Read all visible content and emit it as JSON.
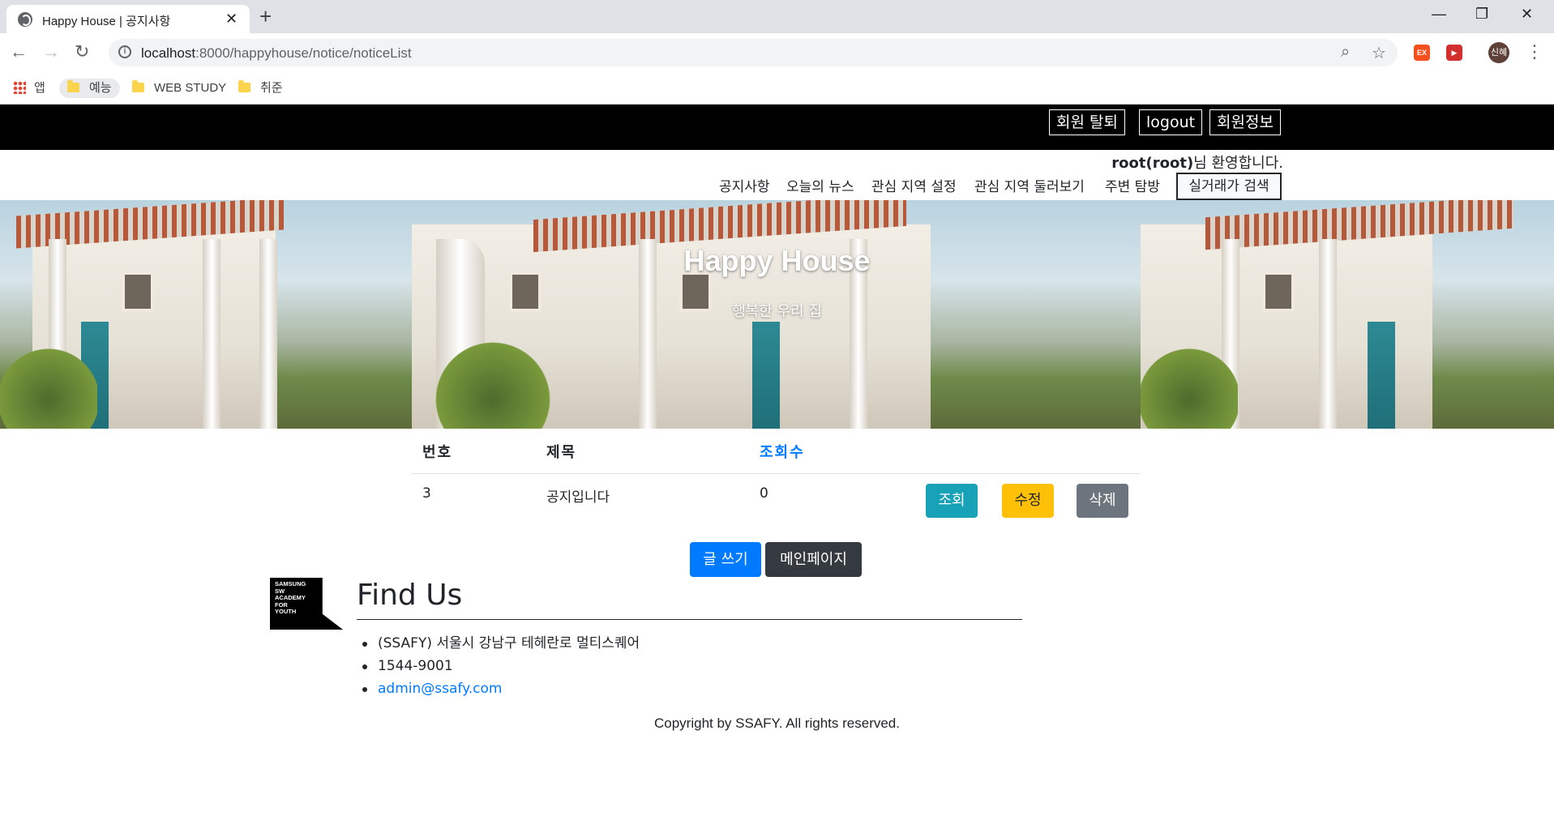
{
  "browser": {
    "tab_title": "Happy House | 공지사항",
    "tab_close": "✕",
    "new_tab": "+",
    "url_host": "localhost",
    "url_rest": ":8000/happyhouse/notice/noticeList",
    "profile_initial": "신혜",
    "window_controls": [
      "—",
      "❐",
      "✕"
    ],
    "bookmarks": [
      {
        "label": "앱",
        "icon": "apps-grid-icon"
      },
      {
        "label": "예능",
        "icon": "folder-icon"
      },
      {
        "label": "WEB STUDY",
        "icon": "folder-icon"
      },
      {
        "label": "취준",
        "icon": "folder-icon"
      }
    ],
    "extensions": [
      {
        "label": "EX",
        "color": "#f4511e"
      },
      {
        "label": "▶",
        "color": "#d32f2f"
      }
    ]
  },
  "topbar": {
    "buttons": [
      "회원 탈퇴",
      "logout",
      "회원정보"
    ]
  },
  "welcome": {
    "user": "root(root)",
    "suffix": "님 환영합니다."
  },
  "menu": {
    "items": [
      "공지사항",
      "오늘의 뉴스",
      "관심 지역 설정",
      "관심 지역 둘러보기",
      "주변 탐방"
    ],
    "search_label": "실거래가 검색"
  },
  "hero": {
    "title": "Happy House",
    "subtitle": "행복한 우리 집"
  },
  "notice_table": {
    "headers": [
      "번호",
      "제목",
      "조회수"
    ],
    "rows": [
      {
        "no": "3",
        "title": "공지입니다",
        "views": "0"
      }
    ],
    "row_buttons": [
      "조회",
      "수정",
      "삭제"
    ]
  },
  "actions": {
    "write_label": "글 쓰기",
    "main_label": "메인페이지"
  },
  "footer": {
    "logo_lines": [
      "SAMSUNG",
      "SW",
      "ACADEMY",
      "FOR",
      "YOUTH"
    ],
    "heading": "Find Us",
    "items": [
      "(SSAFY) 서울시 강남구 테헤란로 멀티스퀘어",
      "1544-9001",
      "admin@ssafy.com"
    ],
    "copyright": "Copyright by SSAFY. All rights reserved."
  },
  "colors": {
    "primary": "#007bff",
    "info": "#17a2b8",
    "warning": "#ffc107",
    "secondary": "#6c757d",
    "dark": "#343a40",
    "topbar": "#000000"
  }
}
